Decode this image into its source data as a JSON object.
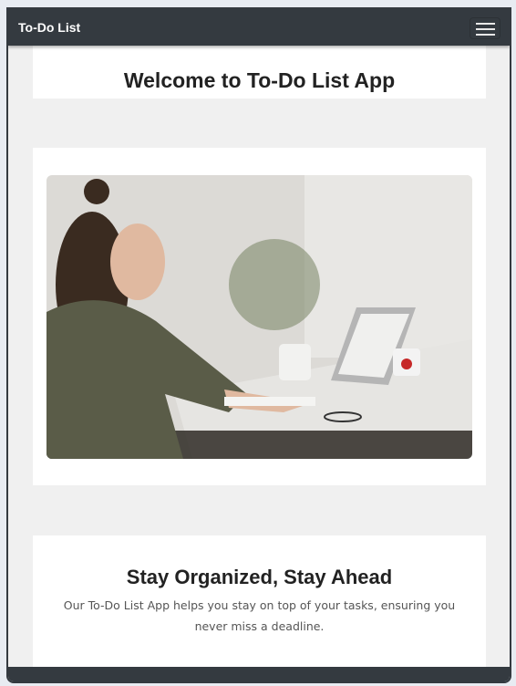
{
  "navbar": {
    "brand": "To-Do List",
    "menu_icon": "hamburger-icon"
  },
  "welcome": {
    "title": "Welcome to To-Do List App"
  },
  "hero": {
    "image": "woman-writing-at-desk-photo"
  },
  "feature": {
    "title": "Stay Organized, Stay Ahead",
    "description": "Our To-Do List App helps you stay on top of your tasks, ensuring you never miss a deadline."
  },
  "colors": {
    "navbar": "#343a40",
    "page_bg": "#f0f0f0",
    "card": "#ffffff"
  }
}
